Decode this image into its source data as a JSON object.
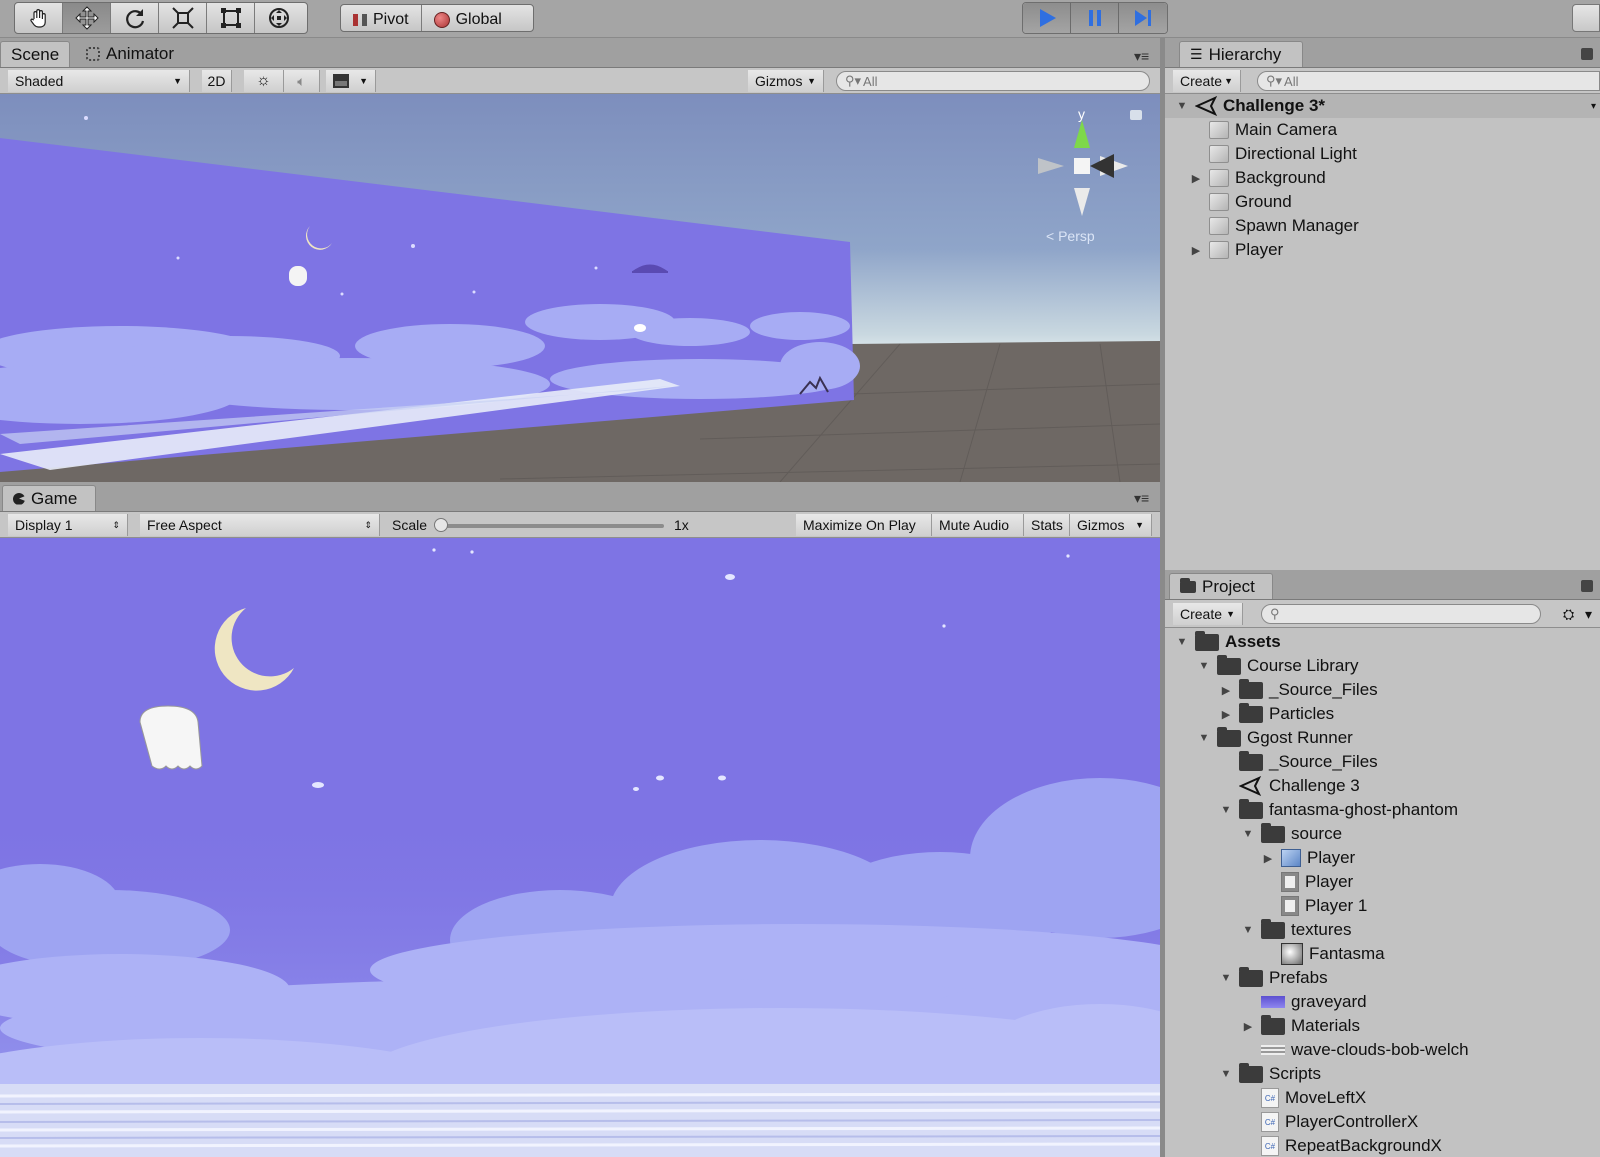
{
  "toolbar": {
    "tools": [
      "hand-icon",
      "move-icon",
      "rotate-icon",
      "scale-icon",
      "rect-icon",
      "transform-icon"
    ],
    "pivot_label": "Pivot",
    "global_label": "Global"
  },
  "scene": {
    "tab_scene": "Scene",
    "tab_animator": "Animator",
    "shading": "Shaded",
    "mode_2d": "2D",
    "gizmos": "Gizmos",
    "search_placeholder": "All",
    "gizmo_y": "y",
    "gizmo_persp": "< Persp"
  },
  "game": {
    "tab": "Game",
    "display": "Display 1",
    "aspect": "Free Aspect",
    "scale_label": "Scale",
    "scale_value": "1x",
    "maximize": "Maximize On Play",
    "mute": "Mute Audio",
    "stats": "Stats",
    "gizmos": "Gizmos"
  },
  "hierarchy": {
    "tab": "Hierarchy",
    "create": "Create",
    "search_placeholder": "All",
    "scene_name": "Challenge 3*",
    "items": [
      "Main Camera",
      "Directional Light",
      "Background",
      "Ground",
      "Spawn Manager",
      "Player"
    ]
  },
  "project": {
    "tab": "Project",
    "create": "Create",
    "items": [
      "Assets",
      "Course Library",
      "_Source_Files",
      "Particles",
      "Ggost Runner",
      "_Source_Files",
      "Challenge 3",
      "fantasma-ghost-phantom",
      "source",
      "Player",
      "Player",
      "Player 1",
      "textures",
      "Fantasma",
      "Prefabs",
      "graveyard",
      "Materials",
      "wave-clouds-bob-welch",
      "Scripts",
      "MoveLeftX",
      "PlayerControllerX",
      "RepeatBackgroundX"
    ]
  },
  "colors": {
    "sky_purple": "#7e74e4",
    "cloud": "#a7acf4",
    "play_blue": "#2f6fe0",
    "panel_bg": "#c2c2c2"
  }
}
